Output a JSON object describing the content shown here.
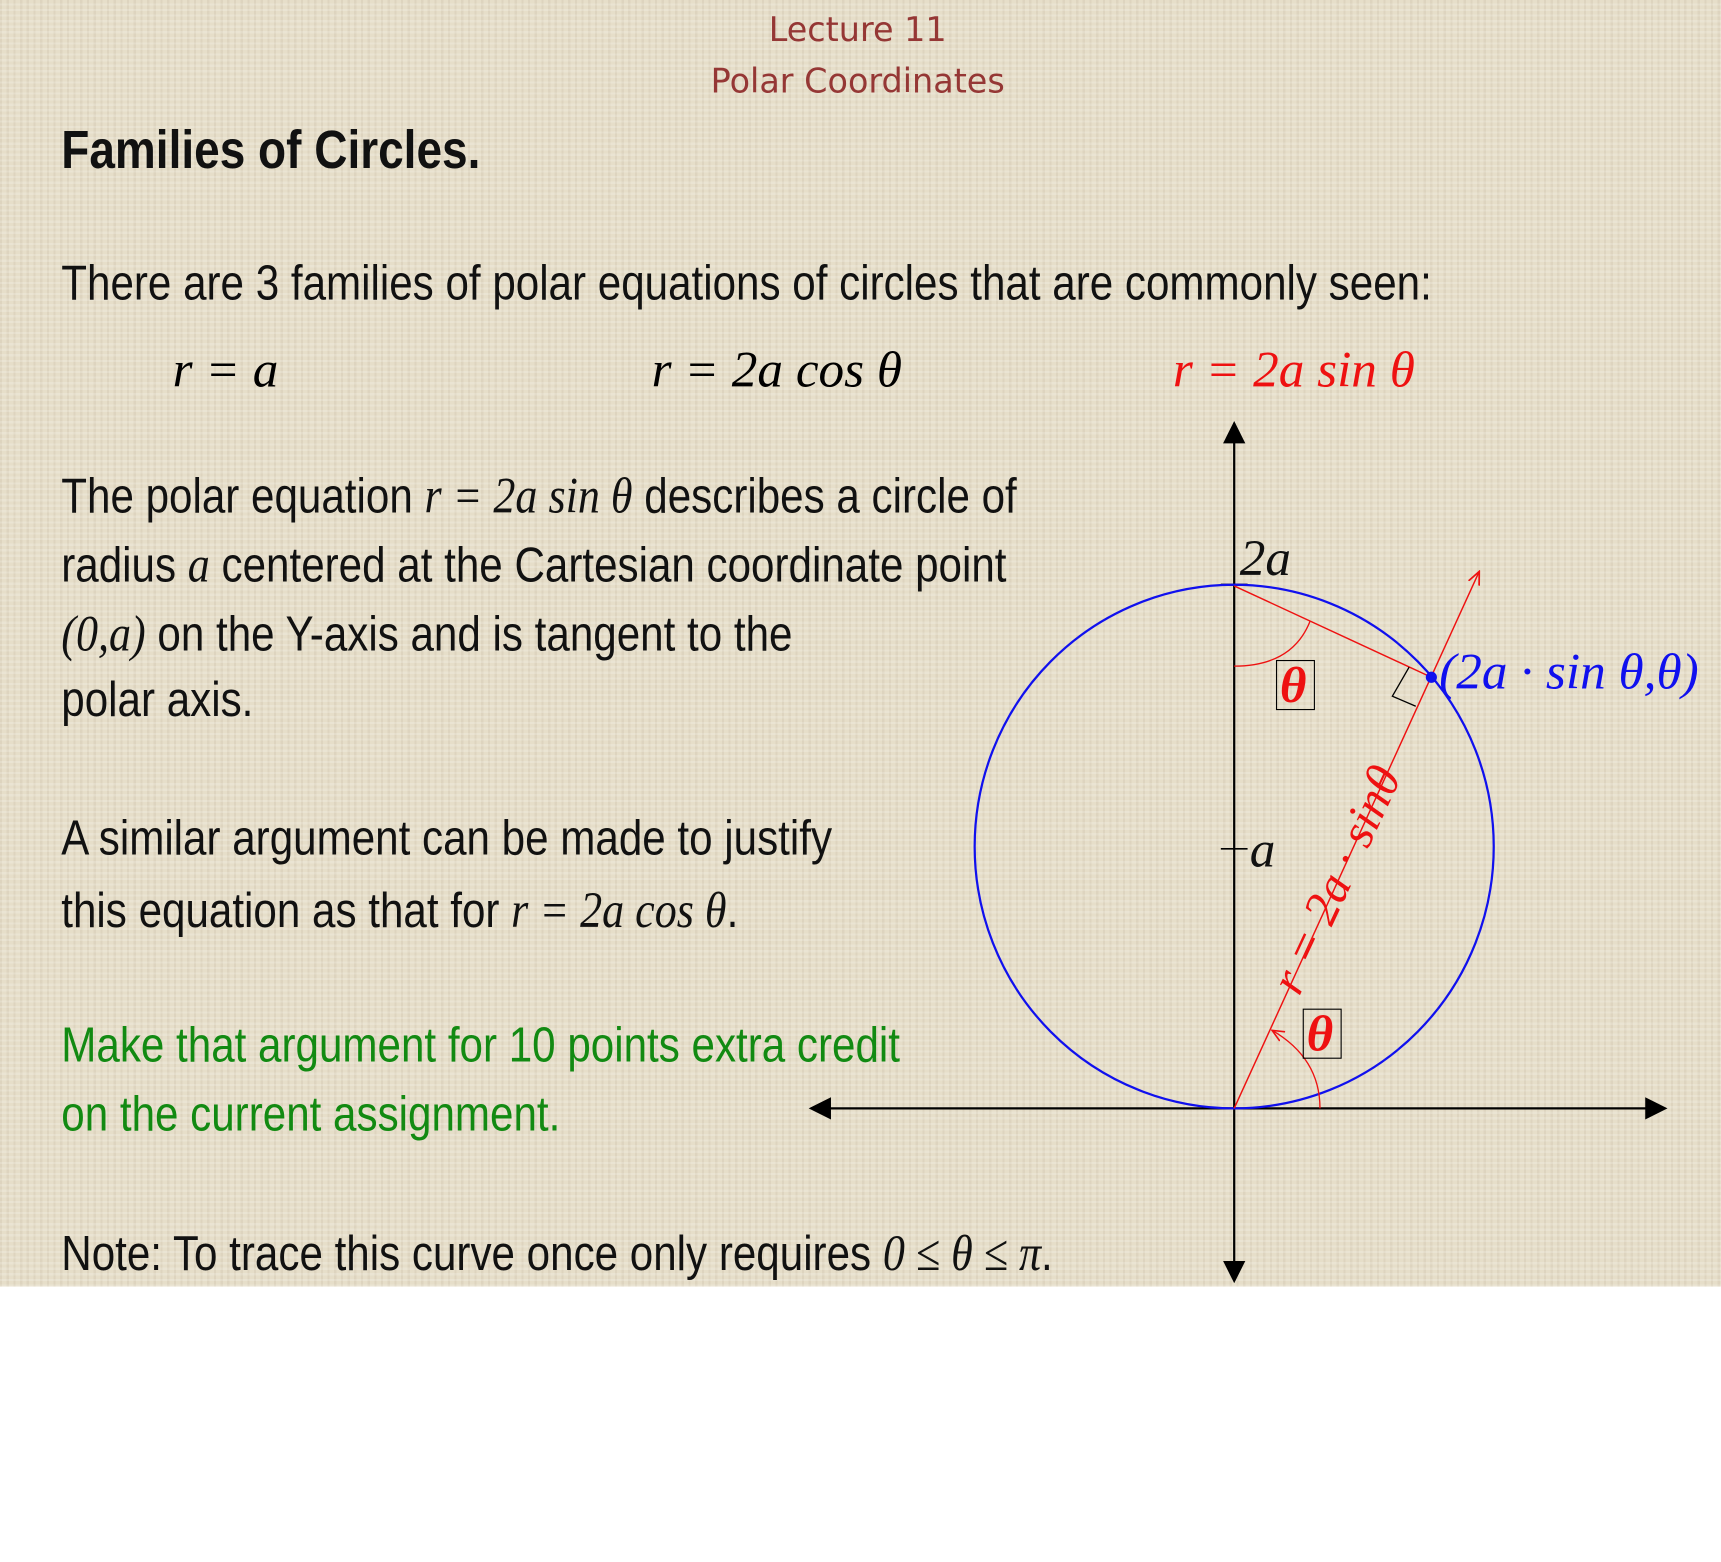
{
  "header": {
    "line1": "Lecture 11",
    "line2": "Polar Coordinates"
  },
  "title": "Families of Circles.",
  "intro": "There are 3 families of polar equations of circles that are commonly seen:",
  "equations": [
    {
      "text": "r = a",
      "color": "#111111"
    },
    {
      "text": "r = 2a cos θ",
      "color": "#111111"
    },
    {
      "text": "r = 2a sin θ",
      "color": "#ee1111"
    }
  ],
  "para1": {
    "l1a": "The polar equation ",
    "l1m": "r = 2a sin θ",
    "l1b": " describes a circle of",
    "l2a": "radius ",
    "l2m": "a",
    "l2b": " centered at the Cartesian coordinate point",
    "l3m": "(0,a)",
    "l3b": " on the Y-axis and is tangent to the",
    "l4": "polar axis."
  },
  "para2": {
    "l1": "A similar argument can be made to justify",
    "l2a": "this equation as that for ",
    "l2m": "r = 2a cos θ",
    "l2b": "."
  },
  "para3": {
    "l1": "Make that argument for 10 points extra credit",
    "l2": "on the current assignment.",
    "color": "#128a12"
  },
  "note": {
    "a": "Note:  To trace this curve once only requires ",
    "m": "0 ≤ θ ≤ π",
    "b": "."
  },
  "diagram": {
    "label_2a": "2a",
    "label_a": "a",
    "theta_top": "θ",
    "theta_bottom": "θ",
    "point_label": "(2a · sin θ,θ)",
    "radius_label": "r = 2a · sinθ",
    "circle_color": "#1010ee",
    "ray_color": "#ee1111"
  }
}
